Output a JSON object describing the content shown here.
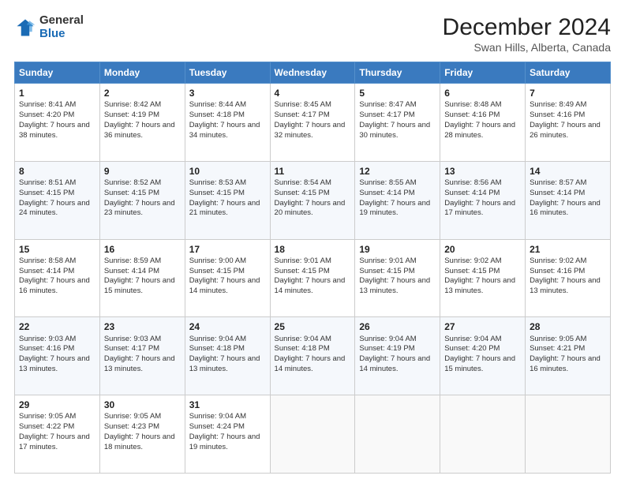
{
  "header": {
    "logo_general": "General",
    "logo_blue": "Blue",
    "title": "December 2024",
    "subtitle": "Swan Hills, Alberta, Canada"
  },
  "calendar": {
    "days_of_week": [
      "Sunday",
      "Monday",
      "Tuesday",
      "Wednesday",
      "Thursday",
      "Friday",
      "Saturday"
    ],
    "weeks": [
      [
        {
          "day": 1,
          "sunrise": "8:41 AM",
          "sunset": "4:20 PM",
          "daylight": "7 hours and 38 minutes."
        },
        {
          "day": 2,
          "sunrise": "8:42 AM",
          "sunset": "4:19 PM",
          "daylight": "7 hours and 36 minutes."
        },
        {
          "day": 3,
          "sunrise": "8:44 AM",
          "sunset": "4:18 PM",
          "daylight": "7 hours and 34 minutes."
        },
        {
          "day": 4,
          "sunrise": "8:45 AM",
          "sunset": "4:17 PM",
          "daylight": "7 hours and 32 minutes."
        },
        {
          "day": 5,
          "sunrise": "8:47 AM",
          "sunset": "4:17 PM",
          "daylight": "7 hours and 30 minutes."
        },
        {
          "day": 6,
          "sunrise": "8:48 AM",
          "sunset": "4:16 PM",
          "daylight": "7 hours and 28 minutes."
        },
        {
          "day": 7,
          "sunrise": "8:49 AM",
          "sunset": "4:16 PM",
          "daylight": "7 hours and 26 minutes."
        }
      ],
      [
        {
          "day": 8,
          "sunrise": "8:51 AM",
          "sunset": "4:15 PM",
          "daylight": "7 hours and 24 minutes."
        },
        {
          "day": 9,
          "sunrise": "8:52 AM",
          "sunset": "4:15 PM",
          "daylight": "7 hours and 23 minutes."
        },
        {
          "day": 10,
          "sunrise": "8:53 AM",
          "sunset": "4:15 PM",
          "daylight": "7 hours and 21 minutes."
        },
        {
          "day": 11,
          "sunrise": "8:54 AM",
          "sunset": "4:15 PM",
          "daylight": "7 hours and 20 minutes."
        },
        {
          "day": 12,
          "sunrise": "8:55 AM",
          "sunset": "4:14 PM",
          "daylight": "7 hours and 19 minutes."
        },
        {
          "day": 13,
          "sunrise": "8:56 AM",
          "sunset": "4:14 PM",
          "daylight": "7 hours and 17 minutes."
        },
        {
          "day": 14,
          "sunrise": "8:57 AM",
          "sunset": "4:14 PM",
          "daylight": "7 hours and 16 minutes."
        }
      ],
      [
        {
          "day": 15,
          "sunrise": "8:58 AM",
          "sunset": "4:14 PM",
          "daylight": "7 hours and 16 minutes."
        },
        {
          "day": 16,
          "sunrise": "8:59 AM",
          "sunset": "4:14 PM",
          "daylight": "7 hours and 15 minutes."
        },
        {
          "day": 17,
          "sunrise": "9:00 AM",
          "sunset": "4:15 PM",
          "daylight": "7 hours and 14 minutes."
        },
        {
          "day": 18,
          "sunrise": "9:01 AM",
          "sunset": "4:15 PM",
          "daylight": "7 hours and 14 minutes."
        },
        {
          "day": 19,
          "sunrise": "9:01 AM",
          "sunset": "4:15 PM",
          "daylight": "7 hours and 13 minutes."
        },
        {
          "day": 20,
          "sunrise": "9:02 AM",
          "sunset": "4:15 PM",
          "daylight": "7 hours and 13 minutes."
        },
        {
          "day": 21,
          "sunrise": "9:02 AM",
          "sunset": "4:16 PM",
          "daylight": "7 hours and 13 minutes."
        }
      ],
      [
        {
          "day": 22,
          "sunrise": "9:03 AM",
          "sunset": "4:16 PM",
          "daylight": "7 hours and 13 minutes."
        },
        {
          "day": 23,
          "sunrise": "9:03 AM",
          "sunset": "4:17 PM",
          "daylight": "7 hours and 13 minutes."
        },
        {
          "day": 24,
          "sunrise": "9:04 AM",
          "sunset": "4:18 PM",
          "daylight": "7 hours and 13 minutes."
        },
        {
          "day": 25,
          "sunrise": "9:04 AM",
          "sunset": "4:18 PM",
          "daylight": "7 hours and 14 minutes."
        },
        {
          "day": 26,
          "sunrise": "9:04 AM",
          "sunset": "4:19 PM",
          "daylight": "7 hours and 14 minutes."
        },
        {
          "day": 27,
          "sunrise": "9:04 AM",
          "sunset": "4:20 PM",
          "daylight": "7 hours and 15 minutes."
        },
        {
          "day": 28,
          "sunrise": "9:05 AM",
          "sunset": "4:21 PM",
          "daylight": "7 hours and 16 minutes."
        }
      ],
      [
        {
          "day": 29,
          "sunrise": "9:05 AM",
          "sunset": "4:22 PM",
          "daylight": "7 hours and 17 minutes."
        },
        {
          "day": 30,
          "sunrise": "9:05 AM",
          "sunset": "4:23 PM",
          "daylight": "7 hours and 18 minutes."
        },
        {
          "day": 31,
          "sunrise": "9:04 AM",
          "sunset": "4:24 PM",
          "daylight": "7 hours and 19 minutes."
        },
        null,
        null,
        null,
        null
      ]
    ]
  }
}
